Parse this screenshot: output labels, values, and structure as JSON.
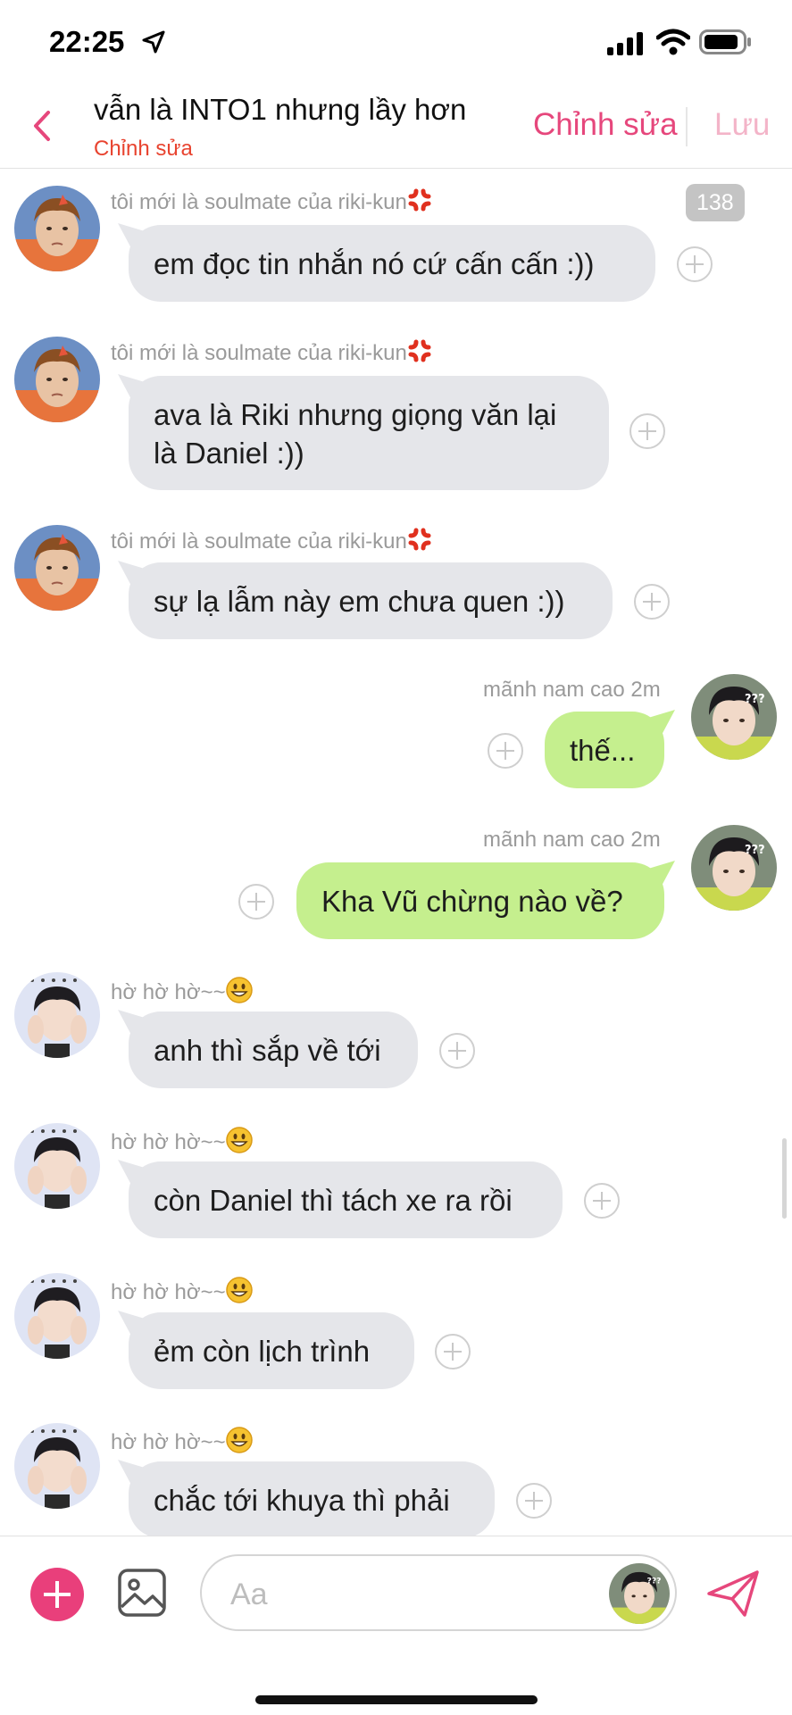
{
  "status": {
    "time": "22:25"
  },
  "header": {
    "title": "vẫn là INTO1 nhưng lầy hơn",
    "subtitle": "Chỉnh sửa",
    "edit_label": "Chỉnh sửa",
    "save_label": "Lưu"
  },
  "badge": {
    "joy": "138 joy"
  },
  "messages": [
    {
      "sender": "tôi mới là soulmate của riki-kun",
      "text": "em đọc tin nhắn nó cứ cấn cấn :))"
    },
    {
      "sender": "tôi mới là soulmate của riki-kun",
      "line1": "ava là Riki nhưng giọng văn lại",
      "line2": "là Daniel :))"
    },
    {
      "sender": "tôi mới là soulmate của riki-kun",
      "text": "sự lạ lẫm này em chưa quen :))"
    },
    {
      "sender": "mãnh nam cao 2m",
      "text": "thế..."
    },
    {
      "sender": "mãnh nam cao 2m",
      "text": "Kha Vũ chừng nào về?"
    },
    {
      "sender": "hờ hờ hờ~~",
      "text": "anh thì sắp về tới"
    },
    {
      "sender": "hờ hờ hờ~~",
      "text": "còn Daniel thì tách xe ra rồi"
    },
    {
      "sender": "hờ hờ hờ~~",
      "text": "ẻm còn lịch trình"
    },
    {
      "sender": "hờ hờ hờ~~",
      "text": "chắc tới khuya thì phải"
    }
  ],
  "composer": {
    "placeholder": "Aa"
  },
  "colors": {
    "accent": "#e6477c",
    "incoming": "#e5e6ea",
    "outgoing": "#c5ef8e"
  }
}
